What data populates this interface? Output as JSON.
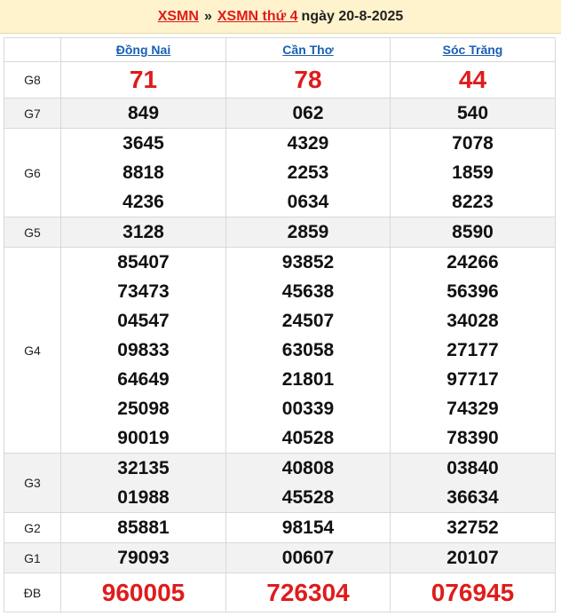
{
  "header": {
    "link1": "XSMN",
    "sep": "»",
    "link2": "XSMN thứ 4",
    "date": "ngày 20-8-2025"
  },
  "columns": [
    "Đồng Nai",
    "Cần Thơ",
    "Sóc Trăng"
  ],
  "rows": [
    {
      "label": "G8",
      "values": [
        [
          "71"
        ],
        [
          "78"
        ],
        [
          "44"
        ]
      ]
    },
    {
      "label": "G7",
      "values": [
        [
          "849"
        ],
        [
          "062"
        ],
        [
          "540"
        ]
      ]
    },
    {
      "label": "G6",
      "values": [
        [
          "3645",
          "8818",
          "4236"
        ],
        [
          "4329",
          "2253",
          "0634"
        ],
        [
          "7078",
          "1859",
          "8223"
        ]
      ]
    },
    {
      "label": "G5",
      "values": [
        [
          "3128"
        ],
        [
          "2859"
        ],
        [
          "8590"
        ]
      ]
    },
    {
      "label": "G4",
      "values": [
        [
          "85407",
          "73473",
          "04547",
          "09833",
          "64649",
          "25098",
          "90019"
        ],
        [
          "93852",
          "45638",
          "24507",
          "63058",
          "21801",
          "00339",
          "40528"
        ],
        [
          "24266",
          "56396",
          "34028",
          "27177",
          "97717",
          "74329",
          "78390"
        ]
      ]
    },
    {
      "label": "G3",
      "values": [
        [
          "32135",
          "01988"
        ],
        [
          "40808",
          "45528"
        ],
        [
          "03840",
          "36634"
        ]
      ]
    },
    {
      "label": "G2",
      "values": [
        [
          "85881"
        ],
        [
          "98154"
        ],
        [
          "32752"
        ]
      ]
    },
    {
      "label": "G1",
      "values": [
        [
          "79093"
        ],
        [
          "00607"
        ],
        [
          "20107"
        ]
      ]
    },
    {
      "label": "ĐB",
      "values": [
        [
          "960005"
        ],
        [
          "726304"
        ],
        [
          "076945"
        ]
      ]
    }
  ]
}
